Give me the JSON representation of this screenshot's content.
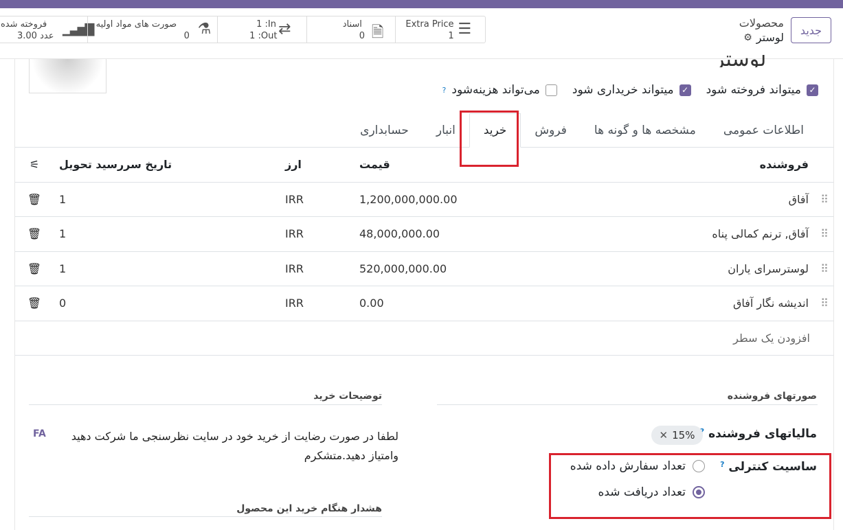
{
  "control_panel": {
    "new_button": "جدید",
    "breadcrumb_parent": "محصولات",
    "breadcrumb_current": "لوستر"
  },
  "smart_buttons": [
    {
      "label": "Extra Price",
      "value": "1"
    },
    {
      "label": "اسناد",
      "value": "0"
    },
    {
      "label": "1 :In",
      "value": "1 :Out"
    },
    {
      "label": "صورت های مواد اولیه",
      "value": "0"
    },
    {
      "label": "فروخته شده",
      "value": "3.00 عدد"
    }
  ],
  "product": {
    "title_partial": "لوستر"
  },
  "options": [
    {
      "label": "میتواند فروخته شود",
      "checked": true
    },
    {
      "label": "میتواند خریداری شود",
      "checked": true
    },
    {
      "label": "می‌تواند هزینه‌شود",
      "checked": false
    }
  ],
  "tabs": [
    "اطلاعات عمومی",
    "مشخصه ها و گونه ها",
    "فروش",
    "خرید",
    "انبار",
    "حسابداری"
  ],
  "active_tab": "خرید",
  "table": {
    "headers": {
      "vendor": "فروشنده",
      "price": "قیمت",
      "currency": "ارز",
      "delivery": "تاریخ سررسید تحویل"
    },
    "rows": [
      {
        "vendor": "آفاق",
        "price": "1,200,000,000.00",
        "currency": "IRR",
        "delivery": "1"
      },
      {
        "vendor": "آفاق, ترنم کمالی پناه",
        "price": "48,000,000.00",
        "currency": "IRR",
        "delivery": "1"
      },
      {
        "vendor": "لوسترسرای یاران",
        "price": "520,000,000.00",
        "currency": "IRR",
        "delivery": "1"
      },
      {
        "vendor": "اندیشه نگار آفاق",
        "price": "0.00",
        "currency": "IRR",
        "delivery": "0"
      }
    ],
    "add_line": "افزودن یک سطر"
  },
  "vendor_bills": {
    "section": "صورتهای فروشنده",
    "tax_label": "مالیاتهای فروشنده",
    "tax_tag": "15%",
    "control_label": "ساسیت کنترلی",
    "control_options": [
      {
        "label": "تعداد سفارش داده شده",
        "selected": false
      },
      {
        "label": "تعداد دریافت شده",
        "selected": true
      }
    ]
  },
  "purchase_desc": {
    "section": "توضیحات خرید",
    "text": "لطفا در صورت رضایت از خرید خود در سایت نظرسنجی ما  شرکت دهید وامتیاز دهید.متشکرم",
    "lang": "FA"
  },
  "warning": {
    "section": "هشدار هنگام خرید این محصول"
  },
  "colors": {
    "brand": "#71639e",
    "highlight": "#d9232e"
  }
}
